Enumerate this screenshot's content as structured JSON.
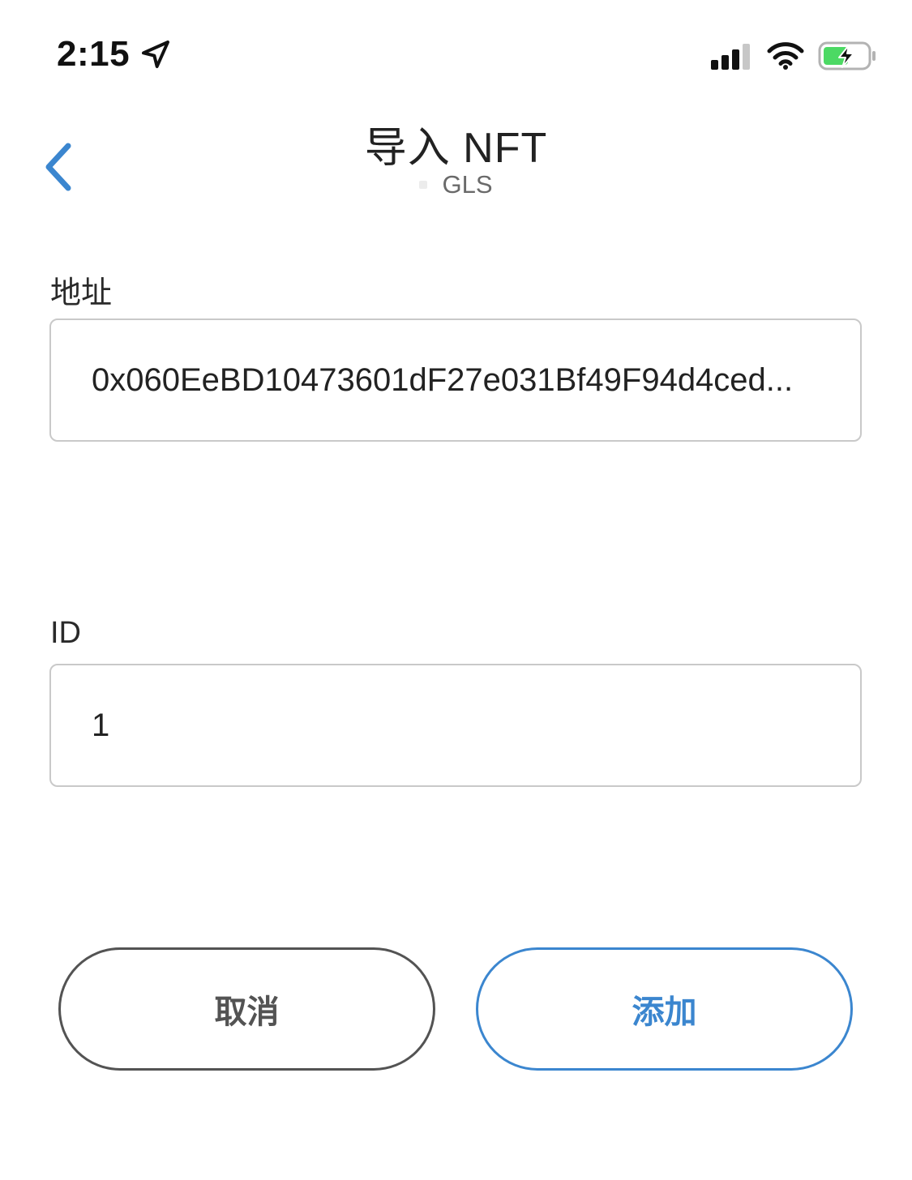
{
  "status_bar": {
    "time": "2:15",
    "icons": [
      "location-arrow-icon",
      "cellular-signal-icon",
      "wifi-icon",
      "battery-charging-icon"
    ]
  },
  "header": {
    "back_icon": "chevron-left-icon",
    "title": "导入 NFT",
    "network": "GLS"
  },
  "form": {
    "address": {
      "label": "地址",
      "value": "0x060EeBD10473601dF27e031Bf49F94d4ced..."
    },
    "id": {
      "label": "ID",
      "value": "1"
    }
  },
  "actions": {
    "cancel_label": "取消",
    "add_label": "添加"
  },
  "colors": {
    "accent": "#3b86cf",
    "cancel": "#535353",
    "border": "#c9c9c9",
    "battery": "#4cd964"
  }
}
